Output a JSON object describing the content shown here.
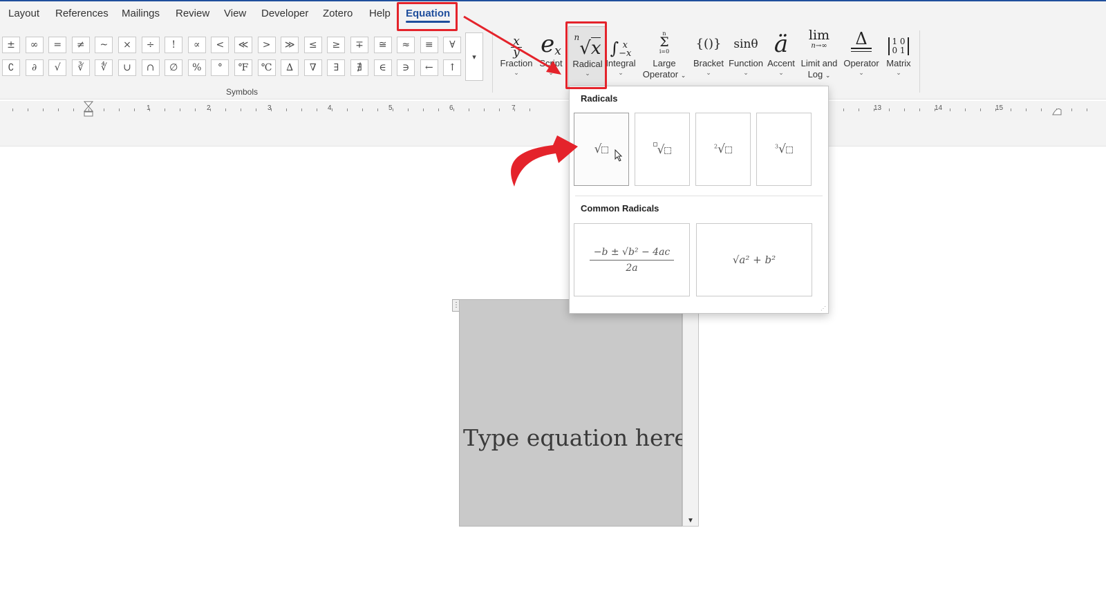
{
  "tabs": [
    {
      "label": "Layout"
    },
    {
      "label": "References"
    },
    {
      "label": "Mailings"
    },
    {
      "label": "Review"
    },
    {
      "label": "View"
    },
    {
      "label": "Developer"
    },
    {
      "label": "Zotero"
    },
    {
      "label": "Help"
    },
    {
      "label": "Equation",
      "active": true
    }
  ],
  "symbols": {
    "row1": [
      "±",
      "∞",
      "=",
      "≠",
      "~",
      "×",
      "÷",
      "!",
      "∝",
      "<",
      "≪",
      ">",
      "≫",
      "≤",
      "≥",
      "∓",
      "≅",
      "≈",
      "≡",
      "∀"
    ],
    "row2": [
      "∁",
      "∂",
      "√",
      "∛",
      "∜",
      "∪",
      "∩",
      "∅",
      "%",
      "°",
      "℉",
      "℃",
      "∆",
      "∇",
      "∃",
      "∄",
      "∈",
      "∋",
      "←",
      "↑"
    ],
    "more_icon": "more-arrow-icon",
    "group_label": "Symbols"
  },
  "structures": [
    {
      "name": "fraction",
      "icon": "x/y",
      "label": "Fraction",
      "label2": "",
      "has_dropdown": true
    },
    {
      "name": "script",
      "icon": "eˣ",
      "label": "Script",
      "label2": "",
      "has_dropdown": true
    },
    {
      "name": "radical",
      "icon": "ⁿ√x",
      "label": "Radical",
      "label2": "",
      "has_dropdown": true
    },
    {
      "name": "integral",
      "icon": "∫ˣ₋ₓ",
      "label": "Integral",
      "label2": "",
      "has_dropdown": true
    },
    {
      "name": "large-operator",
      "icon": "Σ",
      "label": "Large",
      "label2": "Operator",
      "has_dropdown": true
    },
    {
      "name": "bracket",
      "icon": "{()}",
      "label": "Bracket",
      "label2": "",
      "has_dropdown": true
    },
    {
      "name": "function",
      "icon": "sinθ",
      "label": "Function",
      "label2": "",
      "has_dropdown": true
    },
    {
      "name": "accent",
      "icon": "ä",
      "label": "Accent",
      "label2": "",
      "has_dropdown": true
    },
    {
      "name": "limit-log",
      "icon": "lim",
      "label": "Limit and",
      "label2": "Log",
      "has_dropdown": true
    },
    {
      "name": "operator",
      "icon": "Δ",
      "label": "Operator",
      "label2": "",
      "has_dropdown": true
    },
    {
      "name": "matrix",
      "icon": "[10 01]",
      "label": "Matrix",
      "label2": "",
      "has_dropdown": true
    }
  ],
  "ruler": {
    "numbers": [
      "1",
      "2",
      "3",
      "4",
      "5",
      "6",
      "7",
      "13",
      "14",
      "15"
    ]
  },
  "gallery": {
    "section1_title": "Radicals",
    "radicals": [
      {
        "name": "square-root",
        "glyph": "√⬚"
      },
      {
        "name": "radical-with-degree",
        "glyph": "⬚√⬚"
      },
      {
        "name": "square-root-with-degree",
        "glyph": "²√⬚"
      },
      {
        "name": "cube-root",
        "glyph": "³√⬚"
      }
    ],
    "section2_title": "Common Radicals",
    "common": [
      {
        "name": "quadratic-formula",
        "numerator": "−b ± √b² − 4ac",
        "denominator": "2a"
      },
      {
        "name": "pythagorean",
        "formula": "√a² + b²"
      }
    ]
  },
  "equation": {
    "placeholder": "Type equation here."
  },
  "colors": {
    "accent": "#1f4e9c",
    "annotation": "#e4232b",
    "ribbon": "#f3f3f3",
    "equation_bg": "#c9c9c9"
  }
}
